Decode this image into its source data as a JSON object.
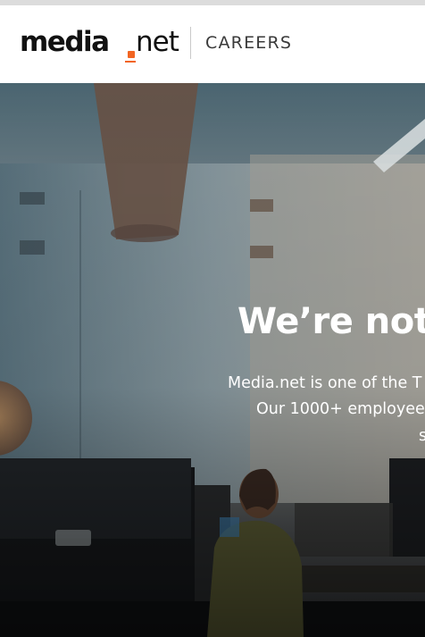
{
  "header": {
    "logo": {
      "part1": "media",
      "part2": "net"
    },
    "section_label": "CAREERS"
  },
  "hero": {
    "title": "We’re not",
    "lines": [
      "Media.net is one of the T",
      "Our 1000+ employee",
      "s"
    ]
  },
  "colors": {
    "brand_accent": "#f26522",
    "logo_text": "#111111",
    "hero_text": "#ffffff"
  }
}
